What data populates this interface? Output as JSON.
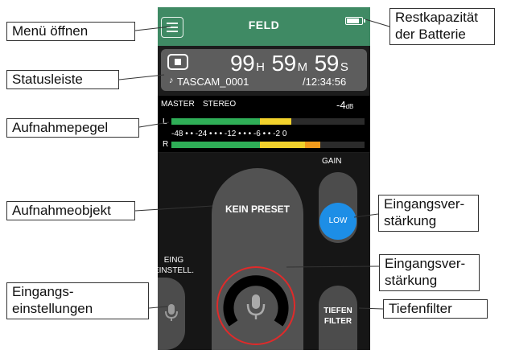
{
  "device": {
    "header": {
      "title": "FELD",
      "battery_level": 0.9
    },
    "status": {
      "hours": "99",
      "hours_unit": "H",
      "minutes": "59",
      "minutes_unit": "M",
      "seconds": "59",
      "seconds_unit": "S",
      "note_icon": "music-note-icon",
      "file_name": "TASCAM_0001",
      "total_time": "/12:34:56"
    },
    "meter": {
      "label_master": "MASTER",
      "label_stereo": "STEREO",
      "level_value": "-4",
      "level_unit": "dB",
      "channel_l": "L",
      "channel_r": "R",
      "scale_text": "-48  •  •  -24  •  •  •  -12  •  •  •  -6  •  •  -2 0",
      "left_level": 0.62,
      "right_level": 0.77
    },
    "gain": {
      "label": "GAIN",
      "value": "LOW"
    },
    "preset": {
      "label": "KEIN PRESET"
    },
    "input_settings": {
      "label": "EING\nEINSTELL."
    },
    "lowcut": {
      "label": "TIEFEN\nFILTER"
    },
    "colors": {
      "header": "#3f8a64",
      "gain_knob": "#1d8ee6",
      "meter_green": "#2fae57",
      "meter_yellow": "#f2d22c",
      "meter_orange": "#f29b1c",
      "rec_ring": "#e02a2a"
    }
  },
  "callouts": {
    "menu": "Menü öffnen",
    "battery": "Restkapazität\nder Batterie",
    "statusbar": "Statusleiste",
    "meter": "Aufnahmepegel",
    "record_object": "Aufnahmeobjekt",
    "gain": "Eingangsver-\nstärkung",
    "input_gain": "Eingangsver-\nstärkung",
    "input_settings": "Eingangs-\neinstellungen",
    "lowcut": "Tiefenfilter"
  }
}
